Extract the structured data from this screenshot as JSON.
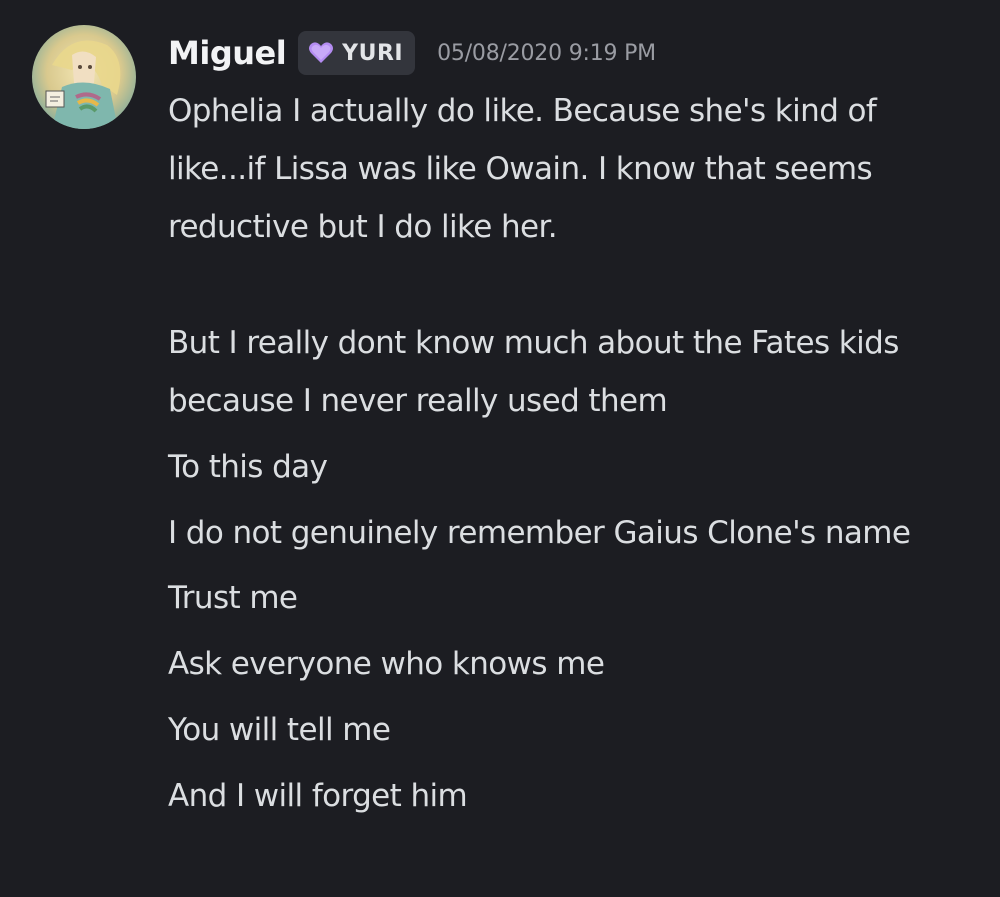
{
  "message": {
    "author": "Miguel",
    "tag": {
      "label": "YURI",
      "icon": "purple-heart-icon",
      "color": "#b48cf2"
    },
    "timestamp": "05/08/2020 9:19 PM",
    "avatar": {
      "icon": "user-avatar-illustration"
    },
    "paragraphs": [
      "Ophelia I actually do like. Because she's kind of like...if Lissa was like Owain. I know that seems reductive but I do like her.",
      "But I really dont know much about the Fates kids because I never really used them"
    ],
    "lines": [
      "To this day",
      "I do not genuinely remember Gaius Clone's name",
      "Trust me",
      "Ask everyone who knows me",
      "You will tell me",
      "And I will forget him"
    ]
  },
  "colors": {
    "background": "#1c1d22",
    "username": "#f2f3f5",
    "text": "#dbdee1",
    "timestamp": "#9a9ca3",
    "tag_background": "#33353c"
  }
}
